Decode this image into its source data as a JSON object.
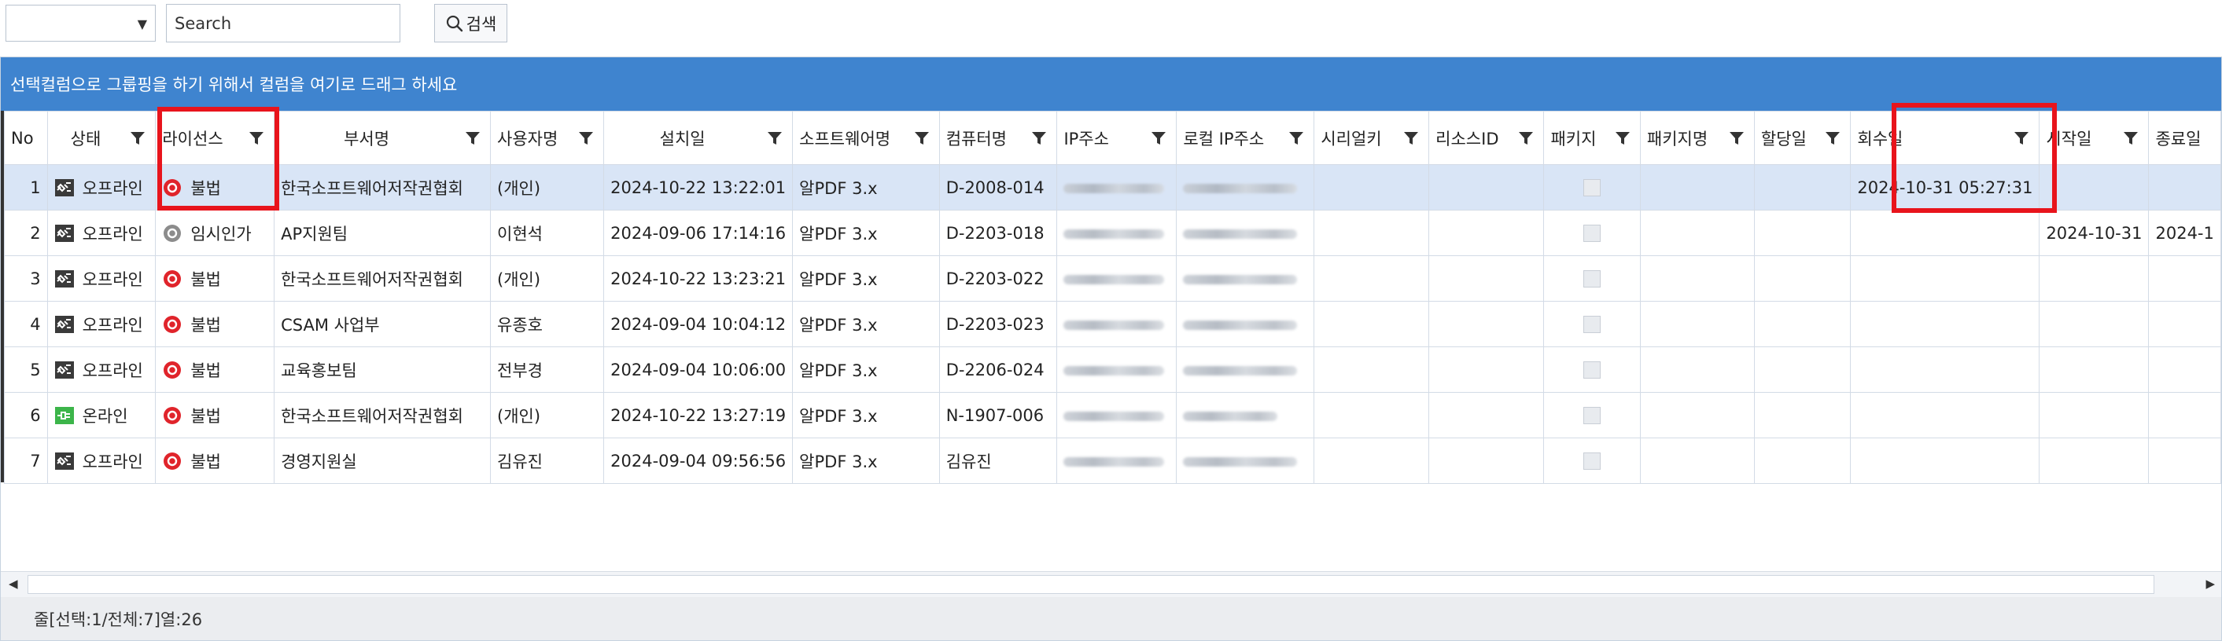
{
  "toolbar": {
    "combo_value": "",
    "search_placeholder": "Search",
    "search_button": "검색"
  },
  "grid": {
    "group_panel_text": "선택컬럼으로 그룹핑을 하기 위해서 컬럼을 여기로 드래그 하세요",
    "columns": [
      "No",
      "상태",
      "라이선스",
      "부서명",
      "사용자명",
      "설치일",
      "소프트웨어명",
      "컴퓨터명",
      "IP주소",
      "로컬 IP주소",
      "시리얼키",
      "리소스ID",
      "패키지",
      "패키지명",
      "할당일",
      "회수일",
      "시작일",
      "종료일"
    ],
    "rows": [
      {
        "no": "1",
        "state": "오프라인",
        "license": "불법",
        "dept": "한국소프트웨어저작권협회",
        "user": "(개인)",
        "install": "2024-10-22 13:22:01",
        "software": "알PDF 3.x",
        "computer": "D-2008-014",
        "ip": "",
        "local_ip": "",
        "serial": "",
        "resource": "",
        "package_name": "",
        "assign": "",
        "revoke": "2024-10-31 05:27:31",
        "start": "",
        "end": ""
      },
      {
        "no": "2",
        "state": "오프라인",
        "license": "임시인가",
        "dept": "AP지원팀",
        "user": "이현석",
        "install": "2024-09-06 17:14:16",
        "software": "알PDF 3.x",
        "computer": "D-2203-018",
        "ip": "",
        "local_ip": "",
        "serial": "",
        "resource": "",
        "package_name": "",
        "assign": "",
        "revoke": "",
        "start": "2024-10-31",
        "end": "2024-1"
      },
      {
        "no": "3",
        "state": "오프라인",
        "license": "불법",
        "dept": "한국소프트웨어저작권협회",
        "user": "(개인)",
        "install": "2024-10-22 13:23:21",
        "software": "알PDF 3.x",
        "computer": "D-2203-022",
        "ip": "",
        "local_ip": "",
        "serial": "",
        "resource": "",
        "package_name": "",
        "assign": "",
        "revoke": "",
        "start": "",
        "end": ""
      },
      {
        "no": "4",
        "state": "오프라인",
        "license": "불법",
        "dept": "CSAM 사업부",
        "user": "유종호",
        "install": "2024-09-04 10:04:12",
        "software": "알PDF 3.x",
        "computer": "D-2203-023",
        "ip": "",
        "local_ip": "",
        "serial": "",
        "resource": "",
        "package_name": "",
        "assign": "",
        "revoke": "",
        "start": "",
        "end": ""
      },
      {
        "no": "5",
        "state": "오프라인",
        "license": "불법",
        "dept": "교육홍보팀",
        "user": "전부경",
        "install": "2024-09-04 10:06:00",
        "software": "알PDF 3.x",
        "computer": "D-2206-024",
        "ip": "",
        "local_ip": "",
        "serial": "",
        "resource": "",
        "package_name": "",
        "assign": "",
        "revoke": "",
        "start": "",
        "end": ""
      },
      {
        "no": "6",
        "state": "온라인",
        "license": "불법",
        "dept": "한국소프트웨어저작권협회",
        "user": "(개인)",
        "install": "2024-10-22 13:27:19",
        "software": "알PDF 3.x",
        "computer": "N-1907-006",
        "ip": "",
        "local_ip": "",
        "serial": "",
        "resource": "",
        "package_name": "",
        "assign": "",
        "revoke": "",
        "start": "",
        "end": ""
      },
      {
        "no": "7",
        "state": "오프라인",
        "license": "불법",
        "dept": "경영지원실",
        "user": "김유진",
        "install": "2024-09-04 09:56:56",
        "software": "알PDF 3.x",
        "computer": "김유진",
        "ip": "",
        "local_ip": "",
        "serial": "",
        "resource": "",
        "package_name": "",
        "assign": "",
        "revoke": "",
        "start": "",
        "end": ""
      }
    ],
    "status_text": "줄[선택:1/전체:7]열:26"
  },
  "colors": {
    "group_panel": "#3f84cf",
    "selected_row": "#d9e5f6",
    "highlight_box": "#e8141c",
    "illegal_icon": "#e0242b",
    "temp_icon": "#8c8c8c",
    "online_icon": "#3cb54a",
    "offline_icon": "#3a3a3a"
  },
  "icons": {
    "offline": "offline-plug-icon",
    "online": "online-plug-icon",
    "illegal": "illegal-license-icon",
    "temporary": "temporary-license-icon",
    "filter": "filter-icon",
    "search": "search-icon"
  }
}
